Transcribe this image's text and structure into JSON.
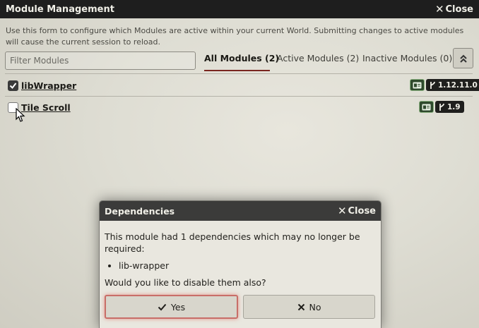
{
  "window": {
    "title": "Module Management",
    "close_label": "Close",
    "notes": "Use this form to configure which Modules are active within your current World. Submitting changes to active modules will cause the current session to reload."
  },
  "filter": {
    "placeholder": "Filter Modules",
    "value": ""
  },
  "tabs": [
    {
      "label": "All Modules (2)",
      "active": true
    },
    {
      "label": "Active Modules (2)",
      "active": false
    },
    {
      "label": "Inactive Modules (0)",
      "active": false
    }
  ],
  "modules": [
    {
      "title": "libWrapper",
      "checked": true,
      "version": "1.12.11.0"
    },
    {
      "title": "Tile Scroll",
      "checked": false,
      "version": "1.9"
    }
  ],
  "dialog": {
    "title": "Dependencies",
    "close_label": "Close",
    "message": "This module had 1 dependencies which may no longer be required:",
    "dependencies": [
      "lib-wrapper"
    ],
    "question": "Would you like to disable them also?",
    "yes_label": "Yes",
    "no_label": "No"
  },
  "colors": {
    "titlebar": "#1e1e1e",
    "active_tab_underline": "#7a2620",
    "compat_badge": "#2f4a2d",
    "version_badge": "#1f1f1d",
    "yes_highlight": "#c86e68"
  }
}
